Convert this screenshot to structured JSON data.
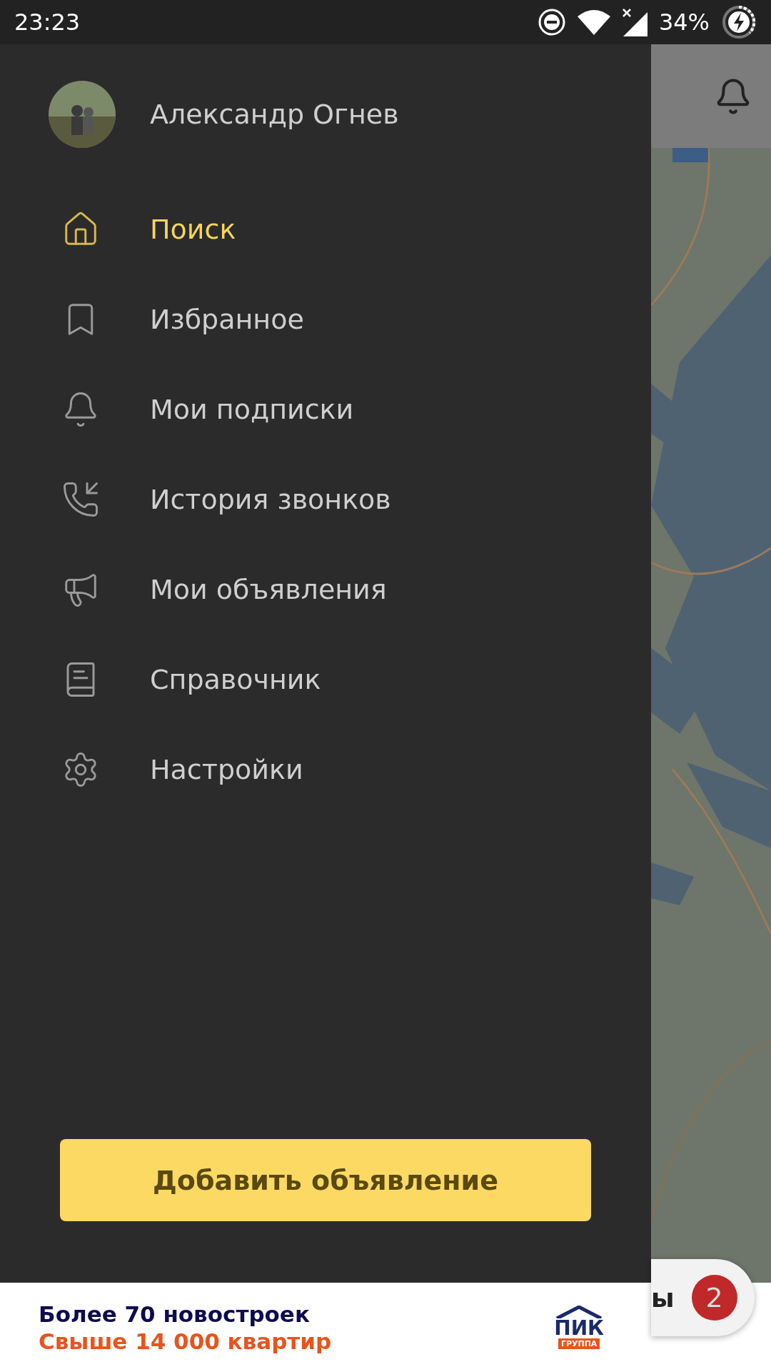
{
  "status_bar": {
    "time": "23:23",
    "battery": "34%"
  },
  "drawer": {
    "user_name": "Александр Огнев",
    "menu": [
      {
        "kind": "home",
        "label": "Поиск",
        "selected": true
      },
      {
        "kind": "bookmark",
        "label": "Избранное",
        "selected": false
      },
      {
        "kind": "bell",
        "label": "Мои подписки",
        "selected": false
      },
      {
        "kind": "phone",
        "label": "История звонков",
        "selected": false
      },
      {
        "kind": "megaphone",
        "label": "Мои объявления",
        "selected": false
      },
      {
        "kind": "book",
        "label": "Справочник",
        "selected": false
      },
      {
        "kind": "gear",
        "label": "Настройки",
        "selected": false
      }
    ],
    "add_button": "Добавить объявление"
  },
  "background": {
    "filter_chip": {
      "label": "ы",
      "count": "2"
    }
  },
  "banner": {
    "line1": "Более 70 новостроек",
    "line2": "Свыше 14 000 квартир",
    "logo_text": "ПИК",
    "logo_sub": "ГРУППА"
  }
}
